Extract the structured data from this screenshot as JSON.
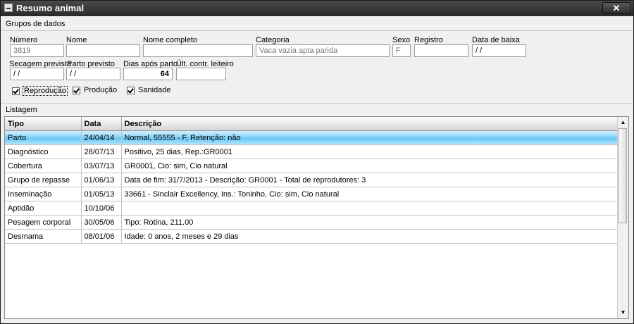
{
  "window": {
    "title": "Resumo animal",
    "close_label": "✕"
  },
  "groups": {
    "label": "Grupos de dados",
    "numero_label": "Número",
    "numero_value": "3819",
    "nome_label": "Nome",
    "nome_value": "",
    "nome_completo_label": "Nome completo",
    "nome_completo_value": "",
    "categoria_label": "Categoria",
    "categoria_value": "Vaca vazia apta parida",
    "sexo_label": "Sexo",
    "sexo_value": "F",
    "registro_label": "Registro",
    "registro_value": "",
    "data_baixa_label": "Data de baixa",
    "data_baixa_value": " / /",
    "secagem_label": "Secagem prevista",
    "secagem_value": " / /",
    "parto_prev_label": "Parto previsto",
    "parto_prev_value": " / /",
    "dias_label": "Dias após parto",
    "dias_value": "64",
    "ult_label": "Últ. contr. leiteiro",
    "ult_value": ""
  },
  "checks": {
    "reproducao": "Reprodução",
    "producao": "Produção",
    "sanidade": "Sanidade"
  },
  "listagem": {
    "label": "Listagem",
    "headers": {
      "tipo": "Tipo",
      "data": "Data",
      "descricao": "Descrição"
    },
    "rows": [
      {
        "tipo": "Parto",
        "data": "24/04/14",
        "descricao": "Normal, 55555 - F, Retenção: não"
      },
      {
        "tipo": "Diagnóstico",
        "data": "28/07/13",
        "descricao": "Positivo, 25 dias, Rep.:GR0001"
      },
      {
        "tipo": "Cobertura",
        "data": "03/07/13",
        "descricao": "GR0001, Cio: sim, Cio natural"
      },
      {
        "tipo": "Grupo de repasse",
        "data": "01/06/13",
        "descricao": "Data de fim: 31/7/2013 - Descrição: GR0001 - Total de reprodutores: 3"
      },
      {
        "tipo": "Inseminação",
        "data": "01/05/13",
        "descricao": "33661 - Sinclair Excellency, Ins.: Toninho, Cio: sim, Cio natural"
      },
      {
        "tipo": "Aptidão",
        "data": "10/10/06",
        "descricao": ""
      },
      {
        "tipo": "Pesagem corporal",
        "data": "30/05/06",
        "descricao": "Tipo: Rotina, 211.00"
      },
      {
        "tipo": "Desmama",
        "data": "08/01/06",
        "descricao": "Idade: 0 anos, 2 meses e 29 dias"
      }
    ]
  }
}
